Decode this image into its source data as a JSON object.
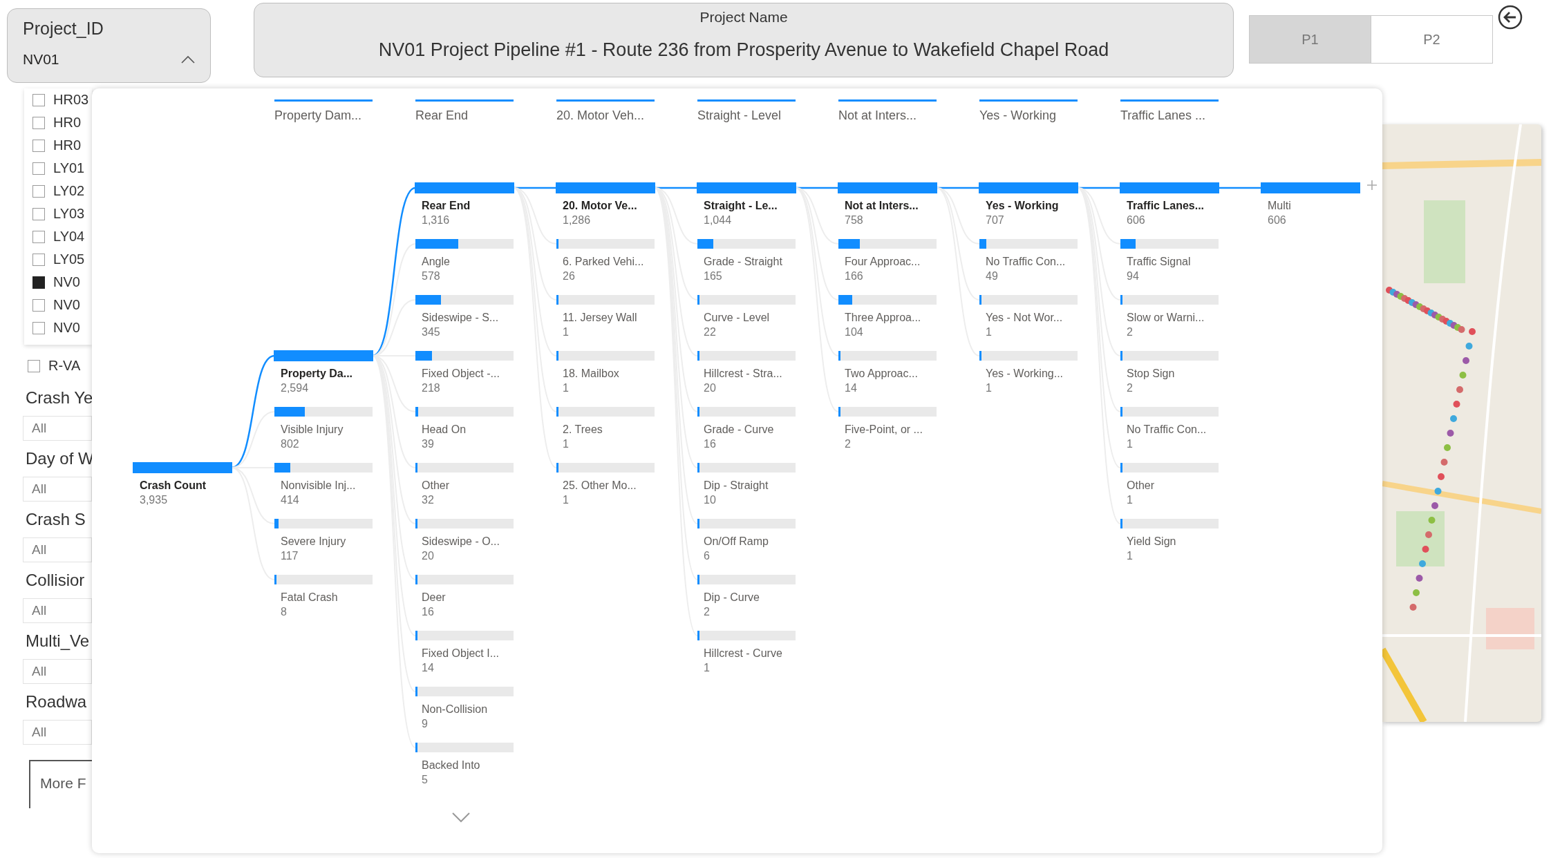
{
  "project_id_slicer": {
    "label": "Project_ID",
    "value": "NV01",
    "expanded": true,
    "options": [
      {
        "label": "HR03",
        "checked": false
      },
      {
        "label": "HR0",
        "checked": false
      },
      {
        "label": "HR0",
        "checked": false
      },
      {
        "label": "LY01",
        "checked": false
      },
      {
        "label": "LY02",
        "checked": false
      },
      {
        "label": "LY03",
        "checked": false
      },
      {
        "label": "LY04",
        "checked": false
      },
      {
        "label": "LY05",
        "checked": false
      },
      {
        "label": "NV0",
        "checked": true
      },
      {
        "label": "NV0",
        "checked": false
      },
      {
        "label": "NV0",
        "checked": false
      }
    ]
  },
  "region_option": {
    "label": "R-VA",
    "checked": false
  },
  "filters": [
    {
      "label": "Crash Ye",
      "value": "All"
    },
    {
      "label": "Day of W",
      "value": "All"
    },
    {
      "label": "Crash S",
      "value": "All"
    },
    {
      "label": "Collisior",
      "value": "All"
    },
    {
      "label": "Multi_Ve",
      "value": "All"
    },
    {
      "label": "Roadwa",
      "value": "All"
    }
  ],
  "more_filters_button": "More F",
  "project_name": {
    "label": "Project Name",
    "value": "NV01 Project Pipeline #1 - Route 236 from Prosperity Avenue to Wakefield Chapel Road"
  },
  "page_toggle": [
    {
      "label": "P1",
      "selected": true
    },
    {
      "label": "P2",
      "selected": false
    }
  ],
  "decomposition_tree": {
    "levels": [
      {
        "nodes": [
          {
            "name": "Crash Count",
            "value": "3,935",
            "level": 1,
            "expanded": true,
            "selected": true
          }
        ]
      },
      {
        "header_value": "Property Dam...",
        "nodes": [
          {
            "name": "Property Da...",
            "value": "2,594",
            "level": 1,
            "expanded": true,
            "selected": true
          },
          {
            "name": "Visible Injury",
            "value": "802",
            "level": 0.31,
            "expanded": false,
            "selected": false
          },
          {
            "name": "Nonvisible Inj...",
            "value": "414",
            "level": 0.16,
            "expanded": false,
            "selected": false
          },
          {
            "name": "Severe Injury",
            "value": "117",
            "level": 0.045,
            "expanded": false,
            "selected": false
          },
          {
            "name": "Fatal Crash",
            "value": "8",
            "level": 0.003,
            "expanded": false,
            "selected": false
          }
        ]
      },
      {
        "header_value": "Rear End",
        "nodes": [
          {
            "name": "Rear End",
            "value": "1,316",
            "level": 1,
            "expanded": true,
            "selected": true
          },
          {
            "name": "Angle",
            "value": "578",
            "level": 0.44,
            "expanded": false,
            "selected": false
          },
          {
            "name": "Sideswipe - S...",
            "value": "345",
            "level": 0.26,
            "expanded": false,
            "selected": false
          },
          {
            "name": "Fixed Object -...",
            "value": "218",
            "level": 0.17,
            "expanded": false,
            "selected": false
          },
          {
            "name": "Head On",
            "value": "39",
            "level": 0.03,
            "expanded": false,
            "selected": false
          },
          {
            "name": "Other",
            "value": "32",
            "level": 0.024,
            "expanded": false,
            "selected": false
          },
          {
            "name": "Sideswipe - O...",
            "value": "20",
            "level": 0.015,
            "expanded": false,
            "selected": false
          },
          {
            "name": "Deer",
            "value": "16",
            "level": 0.012,
            "expanded": false,
            "selected": false
          },
          {
            "name": "Fixed Object I...",
            "value": "14",
            "level": 0.011,
            "expanded": false,
            "selected": false
          },
          {
            "name": "Non-Collision",
            "value": "9",
            "level": 0.007,
            "expanded": false,
            "selected": false
          },
          {
            "name": "Backed Into",
            "value": "5",
            "level": 0.004,
            "expanded": false,
            "selected": false
          }
        ]
      },
      {
        "header_value": "20. Motor Veh...",
        "nodes": [
          {
            "name": "20. Motor Ve...",
            "value": "1,286",
            "level": 1,
            "expanded": true,
            "selected": true
          },
          {
            "name": "6. Parked Vehi...",
            "value": "26",
            "level": 0.02,
            "expanded": false,
            "selected": false
          },
          {
            "name": "11. Jersey Wall",
            "value": "1",
            "level": 0.001,
            "expanded": false,
            "selected": false
          },
          {
            "name": "18. Mailbox",
            "value": "1",
            "level": 0.001,
            "expanded": false,
            "selected": false
          },
          {
            "name": "2. Trees",
            "value": "1",
            "level": 0.001,
            "expanded": false,
            "selected": false
          },
          {
            "name": "25. Other Mo...",
            "value": "1",
            "level": 0.001,
            "expanded": false,
            "selected": false
          }
        ]
      },
      {
        "header_value": "Straight - Level",
        "nodes": [
          {
            "name": "Straight - Le...",
            "value": "1,044",
            "level": 1,
            "expanded": true,
            "selected": true
          },
          {
            "name": "Grade - Straight",
            "value": "165",
            "level": 0.16,
            "expanded": false,
            "selected": false
          },
          {
            "name": "Curve - Level",
            "value": "22",
            "level": 0.021,
            "expanded": false,
            "selected": false
          },
          {
            "name": "Hillcrest - Stra...",
            "value": "20",
            "level": 0.019,
            "expanded": false,
            "selected": false
          },
          {
            "name": "Grade - Curve",
            "value": "16",
            "level": 0.015,
            "expanded": false,
            "selected": false
          },
          {
            "name": "Dip - Straight",
            "value": "10",
            "level": 0.01,
            "expanded": false,
            "selected": false
          },
          {
            "name": "On/Off Ramp",
            "value": "6",
            "level": 0.006,
            "expanded": false,
            "selected": false
          },
          {
            "name": "Dip - Curve",
            "value": "2",
            "level": 0.002,
            "expanded": false,
            "selected": false
          },
          {
            "name": "Hillcrest - Curve",
            "value": "1",
            "level": 0.001,
            "expanded": false,
            "selected": false
          }
        ]
      },
      {
        "header_value": "Not at Inters...",
        "nodes": [
          {
            "name": "Not at Inters...",
            "value": "758",
            "level": 1,
            "expanded": true,
            "selected": true
          },
          {
            "name": "Four Approac...",
            "value": "166",
            "level": 0.22,
            "expanded": false,
            "selected": false
          },
          {
            "name": "Three Approa...",
            "value": "104",
            "level": 0.14,
            "expanded": false,
            "selected": false
          },
          {
            "name": "Two Approac...",
            "value": "14",
            "level": 0.018,
            "expanded": false,
            "selected": false
          },
          {
            "name": "Five-Point, or ...",
            "value": "2",
            "level": 0.003,
            "expanded": false,
            "selected": false
          }
        ]
      },
      {
        "header_value": "Yes - Working",
        "nodes": [
          {
            "name": "Yes - Working",
            "value": "707",
            "level": 1,
            "expanded": true,
            "selected": true
          },
          {
            "name": "No Traffic Con...",
            "value": "49",
            "level": 0.07,
            "expanded": false,
            "selected": false
          },
          {
            "name": "Yes - Not Wor...",
            "value": "1",
            "level": 0.001,
            "expanded": false,
            "selected": false
          },
          {
            "name": "Yes - Working...",
            "value": "1",
            "level": 0.001,
            "expanded": false,
            "selected": false
          }
        ]
      },
      {
        "header_value": "Traffic Lanes ...",
        "nodes": [
          {
            "name": "Traffic Lanes...",
            "value": "606",
            "level": 1,
            "expanded": true,
            "selected": true
          },
          {
            "name": "Traffic Signal",
            "value": "94",
            "level": 0.155,
            "expanded": false,
            "selected": false
          },
          {
            "name": "Slow or Warni...",
            "value": "2",
            "level": 0.003,
            "expanded": false,
            "selected": false
          },
          {
            "name": "Stop Sign",
            "value": "2",
            "level": 0.003,
            "expanded": false,
            "selected": false
          },
          {
            "name": "No Traffic Con...",
            "value": "1",
            "level": 0.002,
            "expanded": false,
            "selected": false
          },
          {
            "name": "Other",
            "value": "1",
            "level": 0.002,
            "expanded": false,
            "selected": false
          },
          {
            "name": "Yield Sign",
            "value": "1",
            "level": 0.002,
            "expanded": false,
            "selected": false
          }
        ]
      },
      {
        "nodes": [
          {
            "name": "Multi",
            "value": "606",
            "level": 1,
            "expanded": false,
            "selected": true
          }
        ]
      }
    ]
  }
}
